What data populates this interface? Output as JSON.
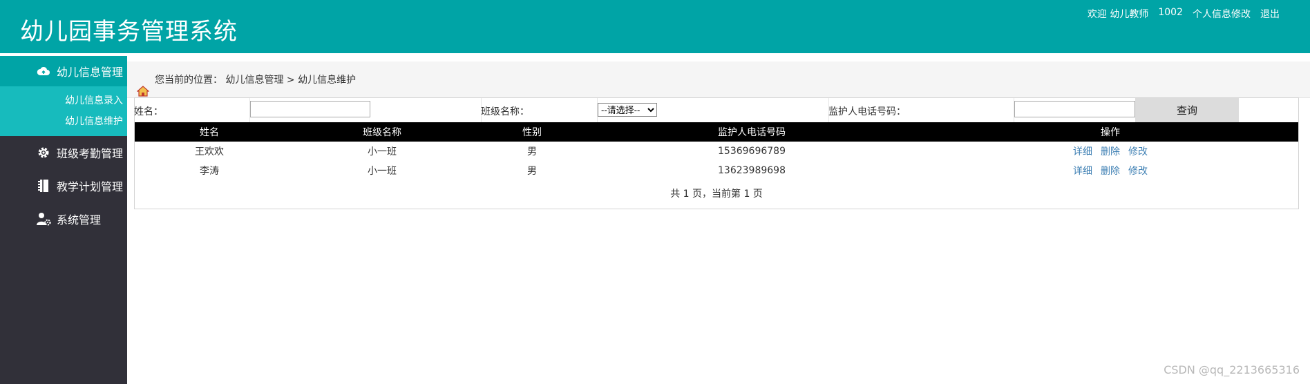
{
  "header": {
    "title": "幼儿园事务管理系统",
    "welcome": "欢迎 幼儿教师",
    "user_id": "1002",
    "profile_link": "个人信息修改",
    "logout_link": "退出"
  },
  "sidebar": {
    "items": [
      {
        "label": "幼儿信息管理",
        "icon": "cloud-icon"
      },
      {
        "label": "班级考勤管理",
        "icon": "gear-icon"
      },
      {
        "label": "教学计划管理",
        "icon": "notebook-icon"
      },
      {
        "label": "系统管理",
        "icon": "user-gear-icon"
      }
    ],
    "submenu": [
      "幼儿信息录入",
      "幼儿信息维护"
    ]
  },
  "breadcrumb": {
    "prefix": "您当前的位置：",
    "path": "幼儿信息管理 > 幼儿信息维护"
  },
  "search": {
    "name_label": "姓名：",
    "name_value": "",
    "class_label": "班级名称：",
    "class_selected": "--请选择--",
    "phone_label": "监护人电话号码：",
    "phone_value": "",
    "query_button": "查询"
  },
  "table": {
    "headers": [
      "姓名",
      "班级名称",
      "性别",
      "监护人电话号码",
      "操作"
    ],
    "rows": [
      {
        "name": "王欢欢",
        "class": "小一班",
        "gender": "男",
        "phone": "15369696789"
      },
      {
        "name": "李涛",
        "class": "小一班",
        "gender": "男",
        "phone": "13623989698"
      }
    ],
    "actions": [
      "详细",
      "删除",
      "修改"
    ]
  },
  "pager": "共 1 页，当前第 1 页",
  "watermark": "CSDN @qq_2213665316",
  "colors": {
    "accent": "#00a4a6",
    "submenu": "#17bbbd",
    "sidebar": "#313039",
    "link": "#3d7fb3"
  }
}
